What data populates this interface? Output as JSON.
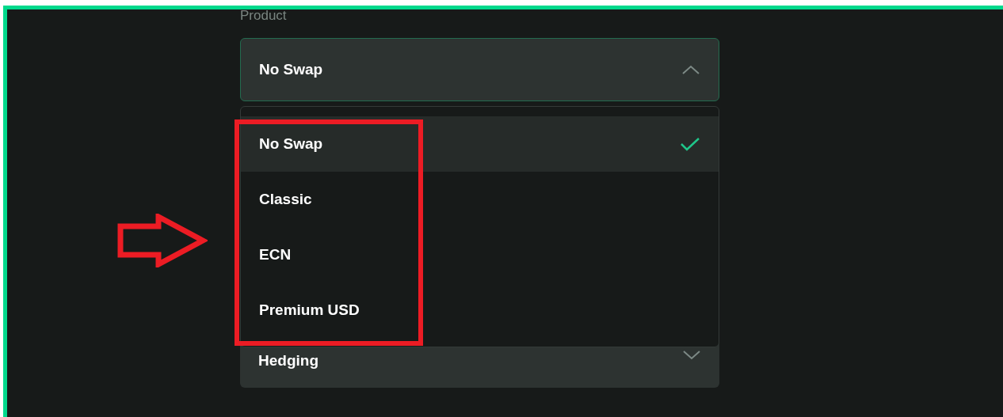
{
  "product_field": {
    "label": "Product",
    "value": "No Swap",
    "expanded": true,
    "options": [
      {
        "label": "No Swap",
        "selected": true
      },
      {
        "label": "Classic",
        "selected": false
      },
      {
        "label": "ECN",
        "selected": false
      },
      {
        "label": "Premium USD",
        "selected": false
      }
    ]
  },
  "next_field": {
    "value": "Hedging",
    "expanded": false
  }
}
